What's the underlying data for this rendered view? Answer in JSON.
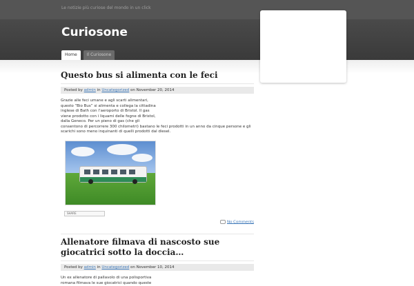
{
  "site": {
    "tagline": "Le notizie più curiose del mondo in un click",
    "title": "Curiosone"
  },
  "nav": {
    "items": [
      {
        "label": "Home"
      },
      {
        "label": "Il Curiosone"
      }
    ]
  },
  "posts": [
    {
      "title": "Questo bus si alimenta con le feci",
      "meta": {
        "posted_by": "Posted by",
        "author": "admin",
        "in": "in",
        "category": "Uncategorized",
        "on": "on",
        "date": "November 20, 2014"
      },
      "body_lines": [
        "Grazie alle feci umane e agli scarti alimentari,",
        "questo “Bio Bus” si alimenta e collega la cittadina",
        "inglese di Bath con l’aeroporto di Bristol. Il gas",
        "viene prodotto con i liquami delle fogne di Bristol,",
        "dalla Geneco. Per un pieno di gas (che gli",
        "consentono di percorrere 300 chilometri) bastano le feci prodotti in un anno da cinque persone e gli",
        "scarichi sono meno inquinanti di quelli prodotti dal diesel."
      ],
      "share_label": "SHARE",
      "comments_label": "No Comments"
    },
    {
      "title": "Allenatore filmava di nascosto sue giocatrici sotto la doccia…",
      "meta": {
        "posted_by": "Posted by",
        "author": "admin",
        "in": "in",
        "category": "Uncategorized",
        "on": "on",
        "date": "November 10, 2014"
      },
      "body_lines": [
        "Un ex allenatore di pallavolo di una polisportiva",
        "romana filmava le sue giocatrici quando queste"
      ]
    }
  ]
}
